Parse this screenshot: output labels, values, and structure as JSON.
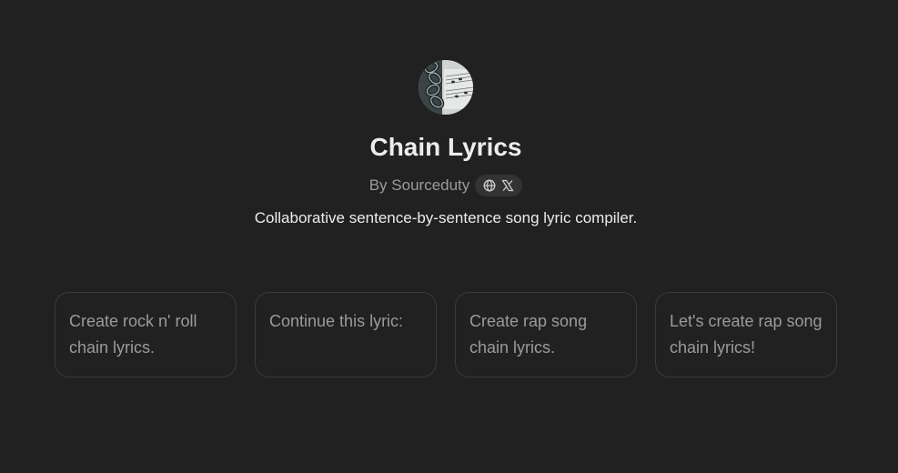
{
  "gpt": {
    "name": "Chain Lyrics",
    "author": "By Sourceduty",
    "description": "Collaborative sentence-by-sentence song lyric compiler."
  },
  "icons": {
    "avatar": "chain-on-sheet-music-image",
    "website": "globe-icon",
    "social": "x-logo-icon"
  },
  "prompts": [
    {
      "text": "Create rock n' roll chain lyrics."
    },
    {
      "text": "Continue this lyric:"
    },
    {
      "text": "Create rap song chain lyrics."
    },
    {
      "text": "Let's create rap song chain lyrics!"
    }
  ],
  "colors": {
    "background": "#212121",
    "title": "#ececec",
    "muted_text": "#9b9b9b",
    "card_border": "#3a3a3a",
    "pill_background": "#333333"
  }
}
